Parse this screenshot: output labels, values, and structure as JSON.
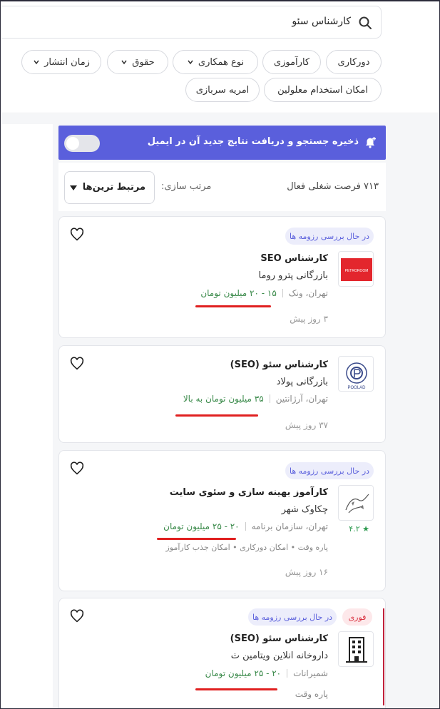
{
  "search": {
    "query": "کارشناس سئو"
  },
  "filters": [
    {
      "label": "دورکاری"
    },
    {
      "label": "کارآموزی"
    },
    {
      "label": "نوع همکاری"
    },
    {
      "label": "حقوق"
    },
    {
      "label": "زمان انتشار"
    },
    {
      "label": "امکان استخدام معلولین"
    },
    {
      "label": "امریه سربازی"
    }
  ],
  "banner": {
    "text": "ذخیره جستجو و دریافت نتایج جدید آن در ایمیل"
  },
  "sort": {
    "count_text": "۷۱۳ فرصت شغلی فعال",
    "label": "مرتب سازی:",
    "value": "مرتبط ترین‌ها"
  },
  "jobs": [
    {
      "status": "در حال بررسی رزومه ها",
      "title": "کارشناس SEO",
      "company": "بازرگانی پترو روما",
      "logo_text": "PETROROOM",
      "location": "تهران، ونک",
      "salary": "۱۵ - ۲۰ میلیون تومان",
      "posted": "۳ روز پیش"
    },
    {
      "title": "کارشناس سئو (SEO)",
      "company": "بازرگانی پولاد",
      "logo_text": "POOLAD",
      "location": "تهران، آرژانتین",
      "salary": "۳۵ میلیون تومان به بالا",
      "posted": "۳۷ روز پیش"
    },
    {
      "status": "در حال بررسی رزومه ها",
      "title": "کارآموز بهینه سازی و سئوی سایت",
      "company": "چکاوک شهر",
      "rating": "۴.۲",
      "location": "تهران، سازمان برنامه",
      "salary": "۲۰ - ۲۵ میلیون تومان",
      "tags": "پاره وقت  •  امکان دورکاری  •  امکان جذب کارآموز",
      "posted": "۱۶ روز پیش"
    },
    {
      "urgent": "فوری",
      "status": "در حال بررسی رزومه ها",
      "title": "کارشناس سئو (SEO)",
      "company": "داروخانه انلاین ویتامین ث",
      "location": "شمیرانات",
      "salary": "۲۰ - ۲۵ میلیون تومان",
      "tags": "پاره وقت"
    }
  ],
  "colors": {
    "accent": "#5a5fdc",
    "salary": "#3a8a4a",
    "annotation": "#e02020",
    "urgent": "#d9303e"
  }
}
